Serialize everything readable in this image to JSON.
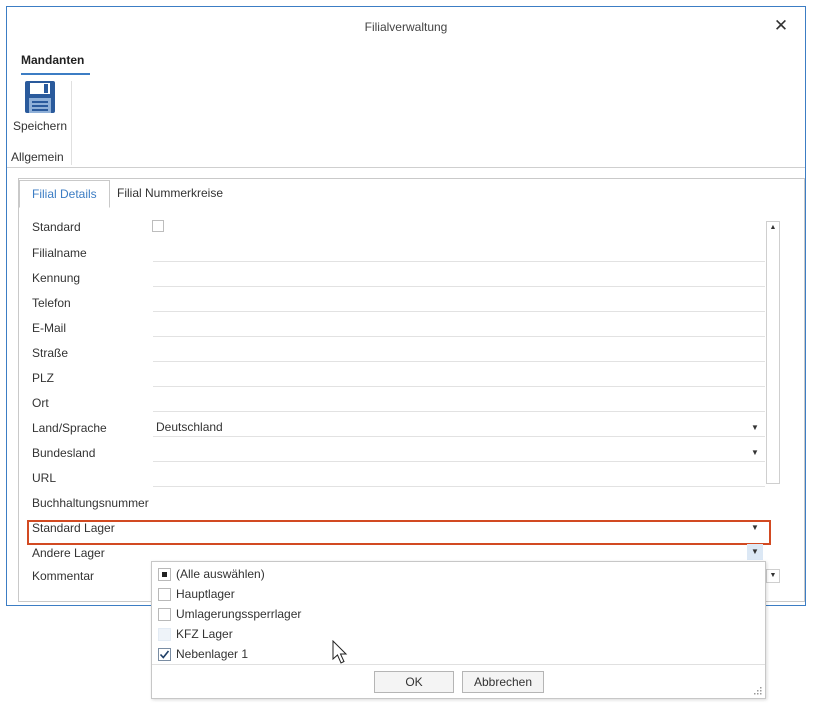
{
  "window": {
    "title": "Filialverwaltung"
  },
  "ribbon": {
    "tab": "Mandanten",
    "save_label": "Speichern",
    "group_label": "Allgemein"
  },
  "tabs": [
    {
      "label": "Filial Details",
      "active": true
    },
    {
      "label": "Filial Nummerkreise",
      "active": false
    }
  ],
  "form": {
    "standard": {
      "label": "Standard",
      "checked": false
    },
    "filialname": {
      "label": "Filialname",
      "value": ""
    },
    "kennung": {
      "label": "Kennung",
      "value": ""
    },
    "telefon": {
      "label": "Telefon",
      "value": ""
    },
    "email": {
      "label": "E-Mail",
      "value": ""
    },
    "strasse": {
      "label": "Straße",
      "value": ""
    },
    "plz": {
      "label": "PLZ",
      "value": ""
    },
    "ort": {
      "label": "Ort",
      "value": ""
    },
    "land": {
      "label": "Land/Sprache",
      "value": "Deutschland"
    },
    "bundesland": {
      "label": "Bundesland",
      "value": ""
    },
    "url": {
      "label": "URL",
      "value": ""
    },
    "buchhaltung": {
      "label": "Buchhaltungsnummer",
      "value": ""
    },
    "standard_lager": {
      "label": "Standard Lager",
      "value": ""
    },
    "andere_lager": {
      "label": "Andere Lager",
      "value": ""
    },
    "kommentar": {
      "label": "Kommentar"
    }
  },
  "popup": {
    "options": [
      {
        "label": "(Alle auswählen)",
        "state": "partial"
      },
      {
        "label": "Hauptlager",
        "state": "unchecked"
      },
      {
        "label": "Umlagerungssperrlager",
        "state": "unchecked"
      },
      {
        "label": "KFZ Lager",
        "state": "disabled"
      },
      {
        "label": "Nebenlager 1",
        "state": "checked"
      }
    ],
    "ok_label": "OK",
    "cancel_label": "Abbrechen"
  },
  "colors": {
    "accent": "#3c7dc4",
    "highlight": "#d24a22"
  }
}
